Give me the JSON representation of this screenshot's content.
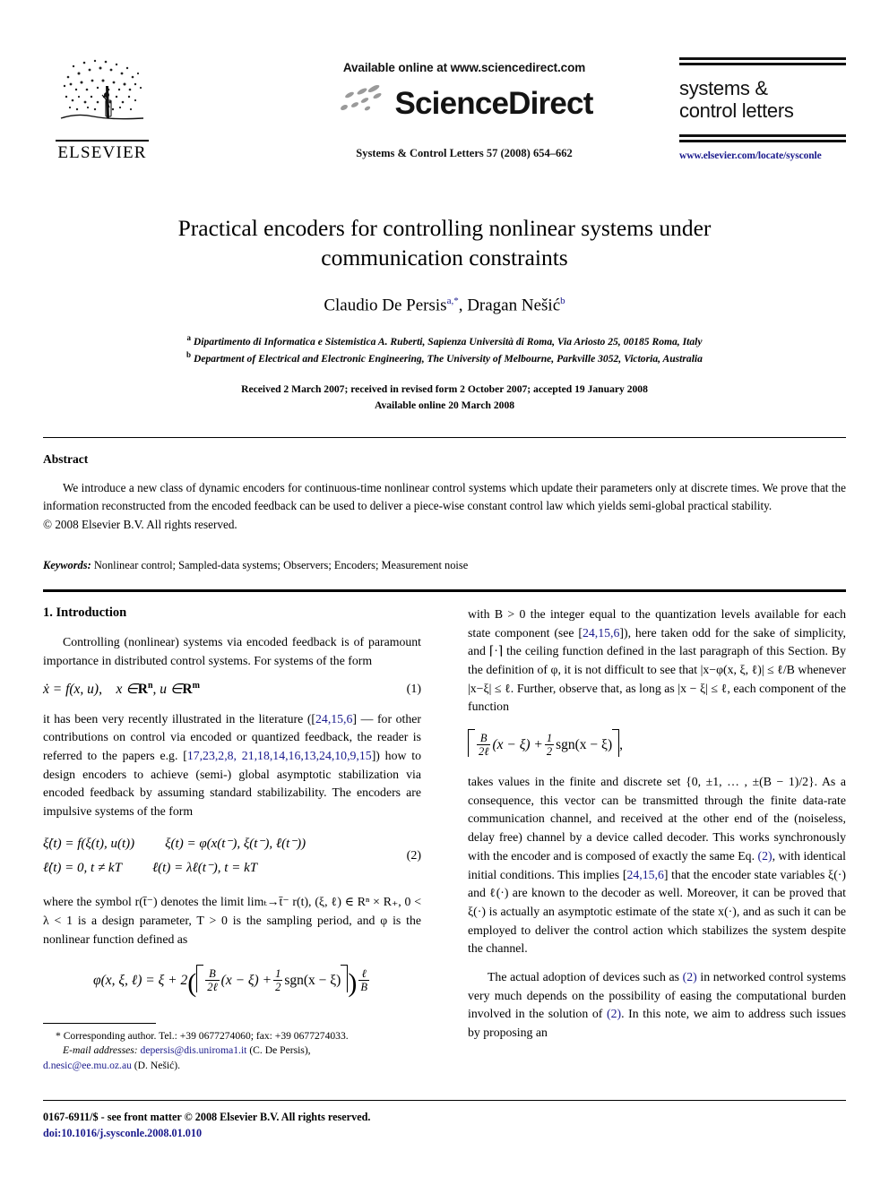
{
  "masthead": {
    "publisher_name": "ELSEVIER",
    "publisher_logo_icon": "elsevier-tree-icon",
    "available_online": "Available online at www.sciencedirect.com",
    "sciencedirect_wordmark": "ScienceDirect",
    "sciencedirect_logo_icon": "sciencedirect-swoosh-icon",
    "journal_reference": "Systems & Control Letters 57 (2008) 654–662",
    "journal_brand_line1": "systems &",
    "journal_brand_line2": "control letters",
    "journal_url": "www.elsevier.com/locate/sysconle"
  },
  "title_block": {
    "title_line1": "Practical encoders for controlling nonlinear systems under",
    "title_line2": "communication constraints",
    "authors_prefix": "Claudio De Persis",
    "authors_sup_a": "a,*",
    "authors_middle": ", Dragan Nešić",
    "authors_sup_b": "b",
    "affiliation_a_marker": "a",
    "affiliation_a": "Dipartimento di Informatica e Sistemistica A. Ruberti, Sapienza Università di Roma, Via Ariosto 25, 00185 Roma, Italy",
    "affiliation_b_marker": "b",
    "affiliation_b": "Department of Electrical and Electronic Engineering, The University of Melbourne, Parkville 3052, Victoria, Australia",
    "received_line": "Received 2 March 2007; received in revised form 2 October 2007; accepted 19 January 2008",
    "available_line": "Available online 20 March 2008"
  },
  "abstract": {
    "heading": "Abstract",
    "text": "We introduce a new class of dynamic encoders for continuous-time nonlinear control systems which update their parameters only at discrete times. We prove that the information reconstructed from the encoded feedback can be used to deliver a piece-wise constant control law which yields semi-global practical stability.",
    "copyright": "© 2008 Elsevier B.V. All rights reserved.",
    "keywords_label": "Keywords:",
    "keywords_value": "Nonlinear control; Sampled-data systems; Observers; Encoders; Measurement noise"
  },
  "left_column": {
    "section_heading": "1. Introduction",
    "para1_a": "Controlling (nonlinear) systems via encoded feedback is of paramount importance in distributed control systems. For systems of the form",
    "eq1": {
      "number": "(1)",
      "lhs": "ẋ = f(x, u),",
      "rhs_x": "x ∈",
      "rhs_rn": "R",
      "rhs_rn_sup": "n",
      "rhs_u": ", u ∈",
      "rhs_rm": "R",
      "rhs_rm_sup": "m"
    },
    "para2_pre": "it has been very recently illustrated in the literature ([",
    "para2_cite1": "24,15,6",
    "para2_mid": "] — for other contributions on control via encoded or quantized feedback, the reader is referred to the papers e.g. [",
    "para2_cite2": "17,23,2,8, 21,18,14,16,13,24,10,9,15",
    "para2_post": "]) how to design encoders to achieve (semi-) global asymptotic stabilization via encoded feedback by assuming standard stabilizability. The encoders are impulsive systems of the form",
    "eq2": {
      "number": "(2)",
      "line1_left": "ξ̇(t) = f(ξ(t), u(t))",
      "line1_right": "ξ(t) = φ(x(t⁻), ξ(t⁻), ℓ(t⁻))",
      "line2_left": "ℓ̇(t) = 0,  t ≠ kT",
      "line2_right": "ℓ(t) = λℓ(t⁻),  t = kT"
    },
    "para3": "where the symbol r(t̄⁻) denotes the limit limₜ→t̄⁻ r(t), (ξ, ℓ) ∈ Rⁿ × R₊, 0 < λ < 1 is a design parameter, T > 0 is the sampling period, and φ is the nonlinear function defined as",
    "eq3": {
      "lhs": "φ(x, ξ, ℓ) = ξ + 2",
      "frac1_num": "B",
      "frac1_den": "2ℓ",
      "mid1": "(x − ξ) +",
      "frac2_num": "1",
      "frac2_den": "2",
      "mid2": "sgn(x − ξ)",
      "frac3_num": "ℓ",
      "frac3_den": "B"
    }
  },
  "right_column": {
    "para1_pre": "with B > 0 the integer equal to the quantization levels available for each state component (see [",
    "para1_cite": "24,15,6",
    "para1_post": "]), here taken odd for the sake of simplicity, and ⌈·⌉ the ceiling function defined in the last paragraph of this Section. By the definition of φ, it is not difficult to see that |x−φ(x, ξ, ℓ)| ≤ ℓ/B whenever |x−ξ| ≤ ℓ. Further, observe that, as long as |x − ξ| ≤ ℓ, each component of the function",
    "eq4": {
      "frac1_num": "B",
      "frac1_den": "2ℓ",
      "mid1": "(x − ξ) +",
      "frac2_num": "1",
      "frac2_den": "2",
      "mid2": "sgn(x − ξ)",
      "trailing": ","
    },
    "para2_pre": "takes values in the finite and discrete set {0, ±1, … , ±(B − 1)/2}. As a consequence, this vector can be transmitted through the finite data-rate communication channel, and received at the other end of the (noiseless, delay free) channel by a device called decoder. This works synchronously with the encoder and is composed of exactly the same Eq. ",
    "para2_cite_eq2": "(2)",
    "para2_mid": ", with identical initial conditions. This implies [",
    "para2_cite": "24,15,6",
    "para2_post": "] that the encoder state variables ξ(·) and ℓ(·) are known to the decoder as well. Moreover, it can be proved that ξ(·) is actually an asymptotic estimate of the state x(·), and as such it can be employed to deliver the control action which stabilizes the system despite the channel.",
    "para3_pre": "The actual adoption of devices such as ",
    "para3_cite1": "(2)",
    "para3_mid": " in networked control systems very much depends on the possibility of easing the computational burden involved in the solution of ",
    "para3_cite2": "(2)",
    "para3_post": ". In this note, we aim to address such issues by proposing an"
  },
  "footnote": {
    "star": "*",
    "corresponding": "Corresponding author. Tel.: +39 0677274060; fax: +39 0677274033.",
    "emails_label": "E-mail addresses:",
    "email1": "depersis@dis.uniroma1.it",
    "email1_owner": "(C. De Persis),",
    "email2": "d.nesic@ee.mu.oz.au",
    "email2_owner": "(D. Nešić)."
  },
  "footer": {
    "issn_line": "0167-6911/$ - see front matter © 2008 Elsevier B.V. All rights reserved.",
    "doi": "doi:10.1016/j.sysconle.2008.01.010"
  },
  "colors": {
    "link": "#1a1a8c",
    "text": "#000000",
    "page_bg": "#ffffff"
  }
}
